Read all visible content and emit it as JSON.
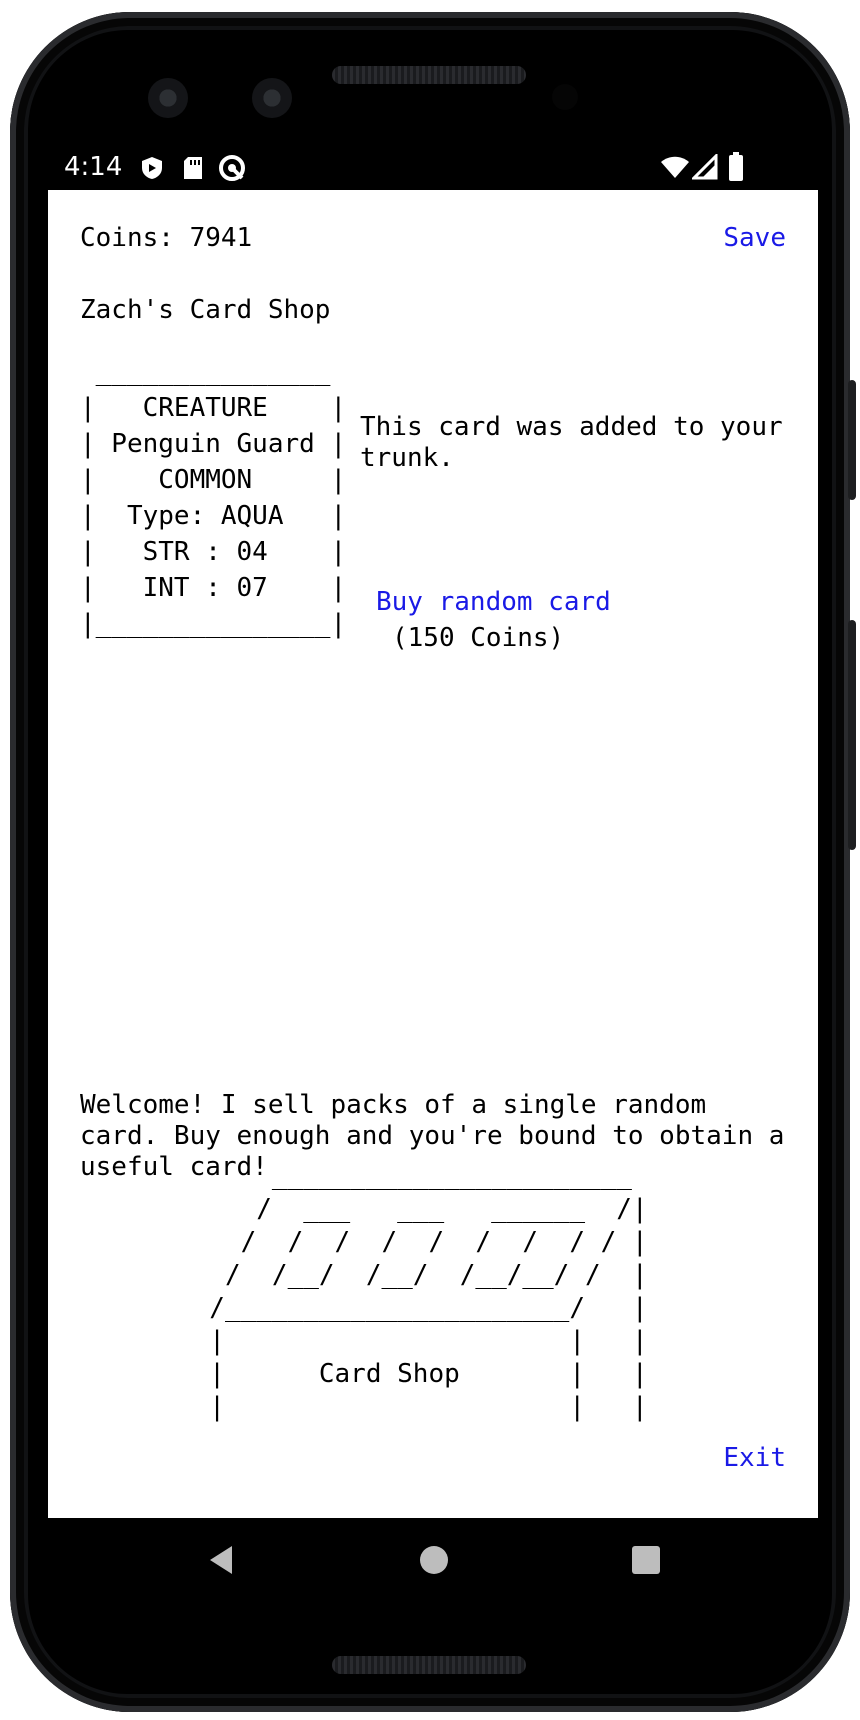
{
  "statusbar": {
    "time": "4:14",
    "icons": [
      "shield-icon",
      "sd-card-icon",
      "sync-icon",
      "wifi-icon",
      "signal-icon",
      "battery-icon"
    ]
  },
  "header": {
    "coins_text": "Coins: 7941",
    "save_label": "Save",
    "shop_title": "Zach's Card Shop"
  },
  "card": {
    "art_lines": [
      " _______________",
      "|   CREATURE    |",
      "| Penguin Guard |",
      "|    COMMON     |",
      "|  Type: AQUA   |",
      "|   STR : 04    |",
      "|   INT : 07    |",
      "|_______________|"
    ],
    "message": "This card was added to your trunk.",
    "buy_label": "Buy random card",
    "buy_cost": "(150 Coins)"
  },
  "shop": {
    "welcome": "Welcome! I sell packs of a single random card. Buy enough and you're bound to obtain a useful card!",
    "art_lines": [
      "      _______________________",
      "     /  ___   ___   ______  /|",
      "    /  /  /  /  /  /  /  / / |",
      "   /  /__/  /__/  /__/__/ /  |",
      "  /______________________/   |",
      "  |                      |   |",
      "  |      Card Shop       |   |",
      "  |                      |   |"
    ],
    "exit_label": "Exit"
  },
  "navbar": {
    "icons": [
      "back-icon",
      "home-icon",
      "recents-icon"
    ]
  },
  "colors": {
    "link": "#1a1ae6",
    "background": "#ffffff",
    "text": "#000000"
  }
}
